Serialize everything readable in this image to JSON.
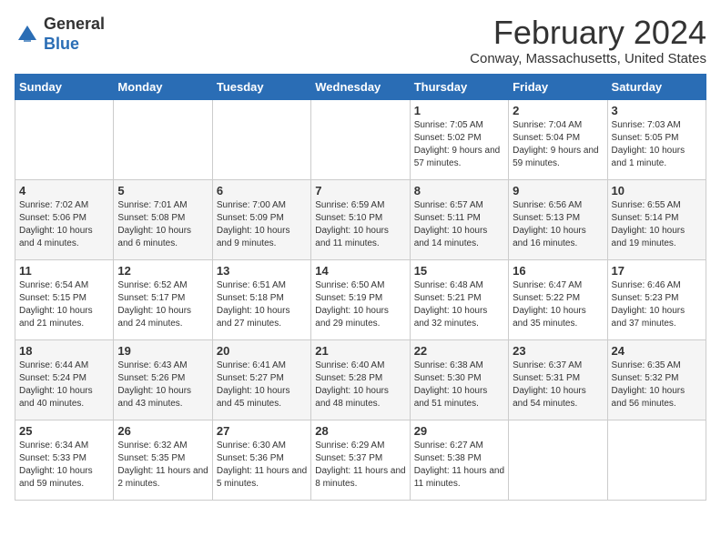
{
  "logo": {
    "general": "General",
    "blue": "Blue"
  },
  "calendar": {
    "title": "February 2024",
    "subtitle": "Conway, Massachusetts, United States"
  },
  "days_of_week": [
    "Sunday",
    "Monday",
    "Tuesday",
    "Wednesday",
    "Thursday",
    "Friday",
    "Saturday"
  ],
  "weeks": [
    [
      {
        "day": "",
        "info": ""
      },
      {
        "day": "",
        "info": ""
      },
      {
        "day": "",
        "info": ""
      },
      {
        "day": "",
        "info": ""
      },
      {
        "day": "1",
        "info": "Sunrise: 7:05 AM\nSunset: 5:02 PM\nDaylight: 9 hours and 57 minutes."
      },
      {
        "day": "2",
        "info": "Sunrise: 7:04 AM\nSunset: 5:04 PM\nDaylight: 9 hours and 59 minutes."
      },
      {
        "day": "3",
        "info": "Sunrise: 7:03 AM\nSunset: 5:05 PM\nDaylight: 10 hours and 1 minute."
      }
    ],
    [
      {
        "day": "4",
        "info": "Sunrise: 7:02 AM\nSunset: 5:06 PM\nDaylight: 10 hours and 4 minutes."
      },
      {
        "day": "5",
        "info": "Sunrise: 7:01 AM\nSunset: 5:08 PM\nDaylight: 10 hours and 6 minutes."
      },
      {
        "day": "6",
        "info": "Sunrise: 7:00 AM\nSunset: 5:09 PM\nDaylight: 10 hours and 9 minutes."
      },
      {
        "day": "7",
        "info": "Sunrise: 6:59 AM\nSunset: 5:10 PM\nDaylight: 10 hours and 11 minutes."
      },
      {
        "day": "8",
        "info": "Sunrise: 6:57 AM\nSunset: 5:11 PM\nDaylight: 10 hours and 14 minutes."
      },
      {
        "day": "9",
        "info": "Sunrise: 6:56 AM\nSunset: 5:13 PM\nDaylight: 10 hours and 16 minutes."
      },
      {
        "day": "10",
        "info": "Sunrise: 6:55 AM\nSunset: 5:14 PM\nDaylight: 10 hours and 19 minutes."
      }
    ],
    [
      {
        "day": "11",
        "info": "Sunrise: 6:54 AM\nSunset: 5:15 PM\nDaylight: 10 hours and 21 minutes."
      },
      {
        "day": "12",
        "info": "Sunrise: 6:52 AM\nSunset: 5:17 PM\nDaylight: 10 hours and 24 minutes."
      },
      {
        "day": "13",
        "info": "Sunrise: 6:51 AM\nSunset: 5:18 PM\nDaylight: 10 hours and 27 minutes."
      },
      {
        "day": "14",
        "info": "Sunrise: 6:50 AM\nSunset: 5:19 PM\nDaylight: 10 hours and 29 minutes."
      },
      {
        "day": "15",
        "info": "Sunrise: 6:48 AM\nSunset: 5:21 PM\nDaylight: 10 hours and 32 minutes."
      },
      {
        "day": "16",
        "info": "Sunrise: 6:47 AM\nSunset: 5:22 PM\nDaylight: 10 hours and 35 minutes."
      },
      {
        "day": "17",
        "info": "Sunrise: 6:46 AM\nSunset: 5:23 PM\nDaylight: 10 hours and 37 minutes."
      }
    ],
    [
      {
        "day": "18",
        "info": "Sunrise: 6:44 AM\nSunset: 5:24 PM\nDaylight: 10 hours and 40 minutes."
      },
      {
        "day": "19",
        "info": "Sunrise: 6:43 AM\nSunset: 5:26 PM\nDaylight: 10 hours and 43 minutes."
      },
      {
        "day": "20",
        "info": "Sunrise: 6:41 AM\nSunset: 5:27 PM\nDaylight: 10 hours and 45 minutes."
      },
      {
        "day": "21",
        "info": "Sunrise: 6:40 AM\nSunset: 5:28 PM\nDaylight: 10 hours and 48 minutes."
      },
      {
        "day": "22",
        "info": "Sunrise: 6:38 AM\nSunset: 5:30 PM\nDaylight: 10 hours and 51 minutes."
      },
      {
        "day": "23",
        "info": "Sunrise: 6:37 AM\nSunset: 5:31 PM\nDaylight: 10 hours and 54 minutes."
      },
      {
        "day": "24",
        "info": "Sunrise: 6:35 AM\nSunset: 5:32 PM\nDaylight: 10 hours and 56 minutes."
      }
    ],
    [
      {
        "day": "25",
        "info": "Sunrise: 6:34 AM\nSunset: 5:33 PM\nDaylight: 10 hours and 59 minutes."
      },
      {
        "day": "26",
        "info": "Sunrise: 6:32 AM\nSunset: 5:35 PM\nDaylight: 11 hours and 2 minutes."
      },
      {
        "day": "27",
        "info": "Sunrise: 6:30 AM\nSunset: 5:36 PM\nDaylight: 11 hours and 5 minutes."
      },
      {
        "day": "28",
        "info": "Sunrise: 6:29 AM\nSunset: 5:37 PM\nDaylight: 11 hours and 8 minutes."
      },
      {
        "day": "29",
        "info": "Sunrise: 6:27 AM\nSunset: 5:38 PM\nDaylight: 11 hours and 11 minutes."
      },
      {
        "day": "",
        "info": ""
      },
      {
        "day": "",
        "info": ""
      }
    ]
  ]
}
